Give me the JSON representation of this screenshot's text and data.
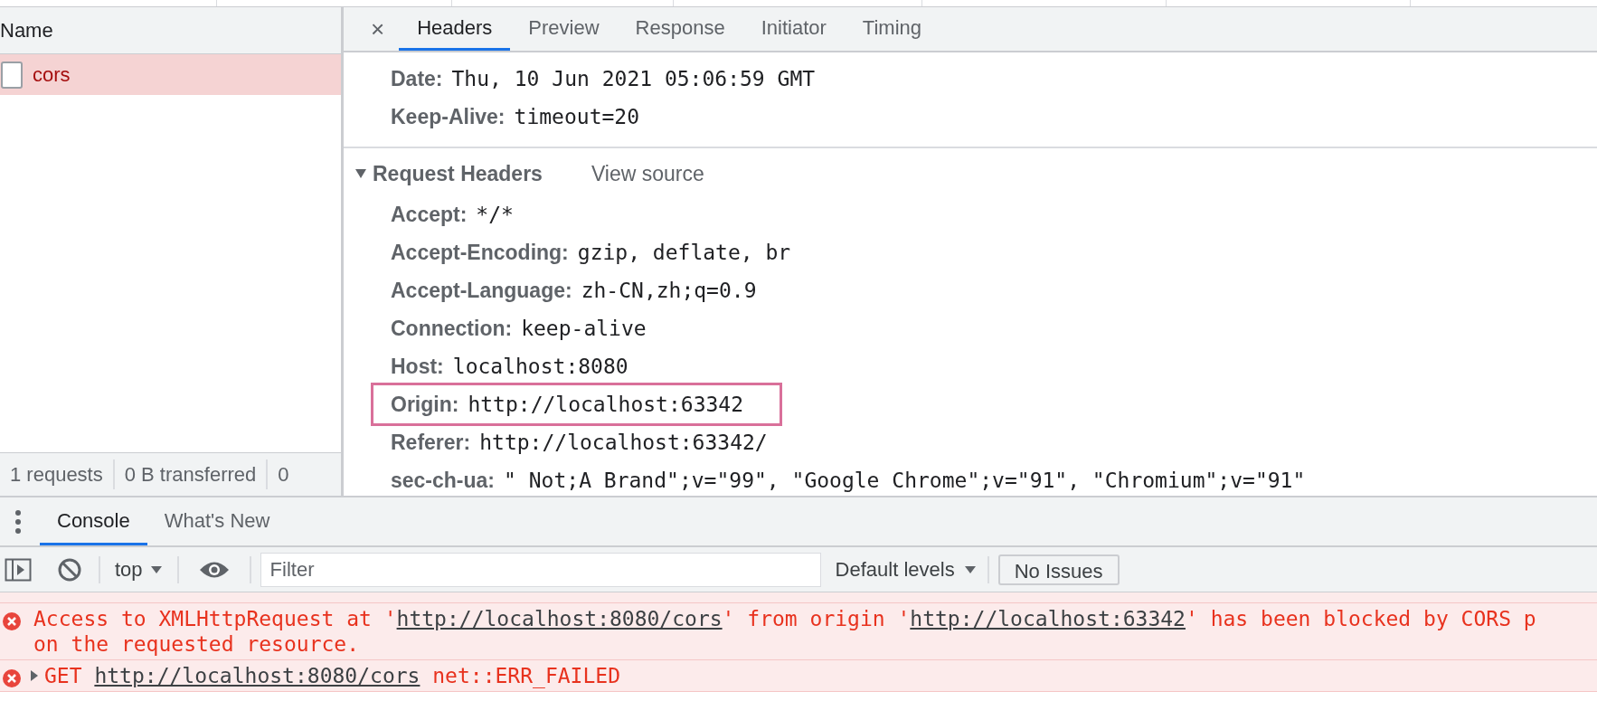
{
  "request_list": {
    "column": "Name",
    "rows": [
      {
        "name": "cors",
        "selected": true,
        "failed": true
      }
    ]
  },
  "status_bar": [
    "1 requests",
    "0 B transferred",
    "0"
  ],
  "detail": {
    "close": "×",
    "tabs": [
      {
        "label": "Headers",
        "selected": true
      },
      {
        "label": "Preview",
        "selected": false
      },
      {
        "label": "Response",
        "selected": false
      },
      {
        "label": "Initiator",
        "selected": false
      },
      {
        "label": "Timing",
        "selected": false
      }
    ],
    "response_headers": [
      {
        "name": "Date:",
        "value": "Thu, 10 Jun 2021 05:06:59 GMT"
      },
      {
        "name": "Keep-Alive:",
        "value": "timeout=20"
      }
    ],
    "request_headers": {
      "title": "Request Headers",
      "view_source": "View source",
      "expanded": true,
      "headers": [
        {
          "name": "Accept:",
          "value": "*/*",
          "highlighted": false
        },
        {
          "name": "Accept-Encoding:",
          "value": "gzip, deflate, br",
          "highlighted": false
        },
        {
          "name": "Accept-Language:",
          "value": "zh-CN,zh;q=0.9",
          "highlighted": false
        },
        {
          "name": "Connection:",
          "value": "keep-alive",
          "highlighted": false
        },
        {
          "name": "Host:",
          "value": "localhost:8080",
          "highlighted": false
        },
        {
          "name": "Origin:",
          "value": "http://localhost:63342",
          "highlighted": true
        },
        {
          "name": "Referer:",
          "value": "http://localhost:63342/",
          "highlighted": false
        },
        {
          "name": "sec-ch-ua:",
          "value": "\" Not;A Brand\";v=\"99\", \"Google Chrome\";v=\"91\", \"Chromium\";v=\"91\"",
          "highlighted": false
        }
      ]
    }
  },
  "drawer": {
    "tabs": [
      {
        "label": "Console",
        "selected": true
      },
      {
        "label": "What's New",
        "selected": false
      }
    ],
    "toolbar": {
      "context": "top",
      "filter_placeholder": "Filter",
      "levels": "Default levels",
      "issues": "No Issues"
    },
    "messages": [
      {
        "kind": "error",
        "expandable": false,
        "lines": [
          [
            {
              "text": "Access to XMLHttpRequest at '",
              "link": false
            },
            {
              "text": "http://localhost:8080/cors",
              "link": true
            },
            {
              "text": "' from origin '",
              "link": false
            },
            {
              "text": "http://localhost:63342",
              "link": true
            },
            {
              "text": "' has been blocked by CORS p",
              "link": false
            }
          ],
          [
            {
              "text": "on the requested resource.",
              "link": false
            }
          ]
        ]
      },
      {
        "kind": "error",
        "expandable": true,
        "lines": [
          [
            {
              "text": "GET ",
              "link": false
            },
            {
              "text": "http://localhost:8080/cors",
              "link": true
            },
            {
              "text": " net::ERR_FAILED",
              "link": false
            }
          ]
        ]
      }
    ]
  }
}
